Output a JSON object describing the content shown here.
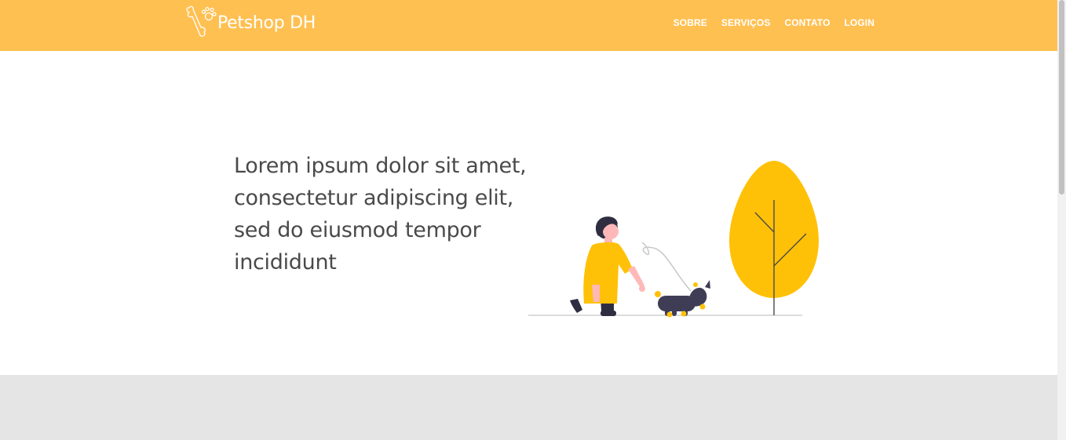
{
  "header": {
    "brand_name": "Petshop DH",
    "logo_icon": "bone-paw-icon",
    "nav": [
      {
        "label": "SOBRE"
      },
      {
        "label": "SERVIÇOS"
      },
      {
        "label": "CONTATO"
      },
      {
        "label": "LOGIN"
      }
    ]
  },
  "hero": {
    "text": "Lorem ipsum dolor sit amet, consectetur adipiscing elit, sed do eiusmod tempor incididunt",
    "illustration_icon": "person-walking-dog-illustration"
  },
  "colors": {
    "header_bg": "#FFC052",
    "accent_yellow": "#FFC107",
    "text": "#4a4a4a",
    "band": "#E5E5E5"
  }
}
